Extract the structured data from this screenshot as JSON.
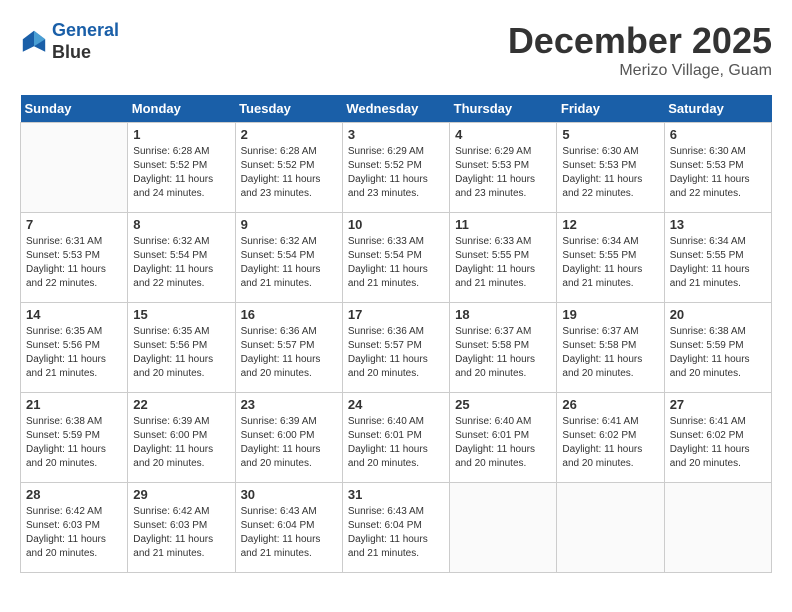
{
  "header": {
    "logo_line1": "General",
    "logo_line2": "Blue",
    "month_title": "December 2025",
    "location": "Merizo Village, Guam"
  },
  "days_of_week": [
    "Sunday",
    "Monday",
    "Tuesday",
    "Wednesday",
    "Thursday",
    "Friday",
    "Saturday"
  ],
  "weeks": [
    [
      {
        "day": "",
        "sunrise": "",
        "sunset": "",
        "daylight": ""
      },
      {
        "day": "1",
        "sunrise": "Sunrise: 6:28 AM",
        "sunset": "Sunset: 5:52 PM",
        "daylight": "Daylight: 11 hours and 24 minutes."
      },
      {
        "day": "2",
        "sunrise": "Sunrise: 6:28 AM",
        "sunset": "Sunset: 5:52 PM",
        "daylight": "Daylight: 11 hours and 23 minutes."
      },
      {
        "day": "3",
        "sunrise": "Sunrise: 6:29 AM",
        "sunset": "Sunset: 5:52 PM",
        "daylight": "Daylight: 11 hours and 23 minutes."
      },
      {
        "day": "4",
        "sunrise": "Sunrise: 6:29 AM",
        "sunset": "Sunset: 5:53 PM",
        "daylight": "Daylight: 11 hours and 23 minutes."
      },
      {
        "day": "5",
        "sunrise": "Sunrise: 6:30 AM",
        "sunset": "Sunset: 5:53 PM",
        "daylight": "Daylight: 11 hours and 22 minutes."
      },
      {
        "day": "6",
        "sunrise": "Sunrise: 6:30 AM",
        "sunset": "Sunset: 5:53 PM",
        "daylight": "Daylight: 11 hours and 22 minutes."
      }
    ],
    [
      {
        "day": "7",
        "sunrise": "Sunrise: 6:31 AM",
        "sunset": "Sunset: 5:53 PM",
        "daylight": "Daylight: 11 hours and 22 minutes."
      },
      {
        "day": "8",
        "sunrise": "Sunrise: 6:32 AM",
        "sunset": "Sunset: 5:54 PM",
        "daylight": "Daylight: 11 hours and 22 minutes."
      },
      {
        "day": "9",
        "sunrise": "Sunrise: 6:32 AM",
        "sunset": "Sunset: 5:54 PM",
        "daylight": "Daylight: 11 hours and 21 minutes."
      },
      {
        "day": "10",
        "sunrise": "Sunrise: 6:33 AM",
        "sunset": "Sunset: 5:54 PM",
        "daylight": "Daylight: 11 hours and 21 minutes."
      },
      {
        "day": "11",
        "sunrise": "Sunrise: 6:33 AM",
        "sunset": "Sunset: 5:55 PM",
        "daylight": "Daylight: 11 hours and 21 minutes."
      },
      {
        "day": "12",
        "sunrise": "Sunrise: 6:34 AM",
        "sunset": "Sunset: 5:55 PM",
        "daylight": "Daylight: 11 hours and 21 minutes."
      },
      {
        "day": "13",
        "sunrise": "Sunrise: 6:34 AM",
        "sunset": "Sunset: 5:55 PM",
        "daylight": "Daylight: 11 hours and 21 minutes."
      }
    ],
    [
      {
        "day": "14",
        "sunrise": "Sunrise: 6:35 AM",
        "sunset": "Sunset: 5:56 PM",
        "daylight": "Daylight: 11 hours and 21 minutes."
      },
      {
        "day": "15",
        "sunrise": "Sunrise: 6:35 AM",
        "sunset": "Sunset: 5:56 PM",
        "daylight": "Daylight: 11 hours and 20 minutes."
      },
      {
        "day": "16",
        "sunrise": "Sunrise: 6:36 AM",
        "sunset": "Sunset: 5:57 PM",
        "daylight": "Daylight: 11 hours and 20 minutes."
      },
      {
        "day": "17",
        "sunrise": "Sunrise: 6:36 AM",
        "sunset": "Sunset: 5:57 PM",
        "daylight": "Daylight: 11 hours and 20 minutes."
      },
      {
        "day": "18",
        "sunrise": "Sunrise: 6:37 AM",
        "sunset": "Sunset: 5:58 PM",
        "daylight": "Daylight: 11 hours and 20 minutes."
      },
      {
        "day": "19",
        "sunrise": "Sunrise: 6:37 AM",
        "sunset": "Sunset: 5:58 PM",
        "daylight": "Daylight: 11 hours and 20 minutes."
      },
      {
        "day": "20",
        "sunrise": "Sunrise: 6:38 AM",
        "sunset": "Sunset: 5:59 PM",
        "daylight": "Daylight: 11 hours and 20 minutes."
      }
    ],
    [
      {
        "day": "21",
        "sunrise": "Sunrise: 6:38 AM",
        "sunset": "Sunset: 5:59 PM",
        "daylight": "Daylight: 11 hours and 20 minutes."
      },
      {
        "day": "22",
        "sunrise": "Sunrise: 6:39 AM",
        "sunset": "Sunset: 6:00 PM",
        "daylight": "Daylight: 11 hours and 20 minutes."
      },
      {
        "day": "23",
        "sunrise": "Sunrise: 6:39 AM",
        "sunset": "Sunset: 6:00 PM",
        "daylight": "Daylight: 11 hours and 20 minutes."
      },
      {
        "day": "24",
        "sunrise": "Sunrise: 6:40 AM",
        "sunset": "Sunset: 6:01 PM",
        "daylight": "Daylight: 11 hours and 20 minutes."
      },
      {
        "day": "25",
        "sunrise": "Sunrise: 6:40 AM",
        "sunset": "Sunset: 6:01 PM",
        "daylight": "Daylight: 11 hours and 20 minutes."
      },
      {
        "day": "26",
        "sunrise": "Sunrise: 6:41 AM",
        "sunset": "Sunset: 6:02 PM",
        "daylight": "Daylight: 11 hours and 20 minutes."
      },
      {
        "day": "27",
        "sunrise": "Sunrise: 6:41 AM",
        "sunset": "Sunset: 6:02 PM",
        "daylight": "Daylight: 11 hours and 20 minutes."
      }
    ],
    [
      {
        "day": "28",
        "sunrise": "Sunrise: 6:42 AM",
        "sunset": "Sunset: 6:03 PM",
        "daylight": "Daylight: 11 hours and 20 minutes."
      },
      {
        "day": "29",
        "sunrise": "Sunrise: 6:42 AM",
        "sunset": "Sunset: 6:03 PM",
        "daylight": "Daylight: 11 hours and 21 minutes."
      },
      {
        "day": "30",
        "sunrise": "Sunrise: 6:43 AM",
        "sunset": "Sunset: 6:04 PM",
        "daylight": "Daylight: 11 hours and 21 minutes."
      },
      {
        "day": "31",
        "sunrise": "Sunrise: 6:43 AM",
        "sunset": "Sunset: 6:04 PM",
        "daylight": "Daylight: 11 hours and 21 minutes."
      },
      {
        "day": "",
        "sunrise": "",
        "sunset": "",
        "daylight": ""
      },
      {
        "day": "",
        "sunrise": "",
        "sunset": "",
        "daylight": ""
      },
      {
        "day": "",
        "sunrise": "",
        "sunset": "",
        "daylight": ""
      }
    ]
  ]
}
